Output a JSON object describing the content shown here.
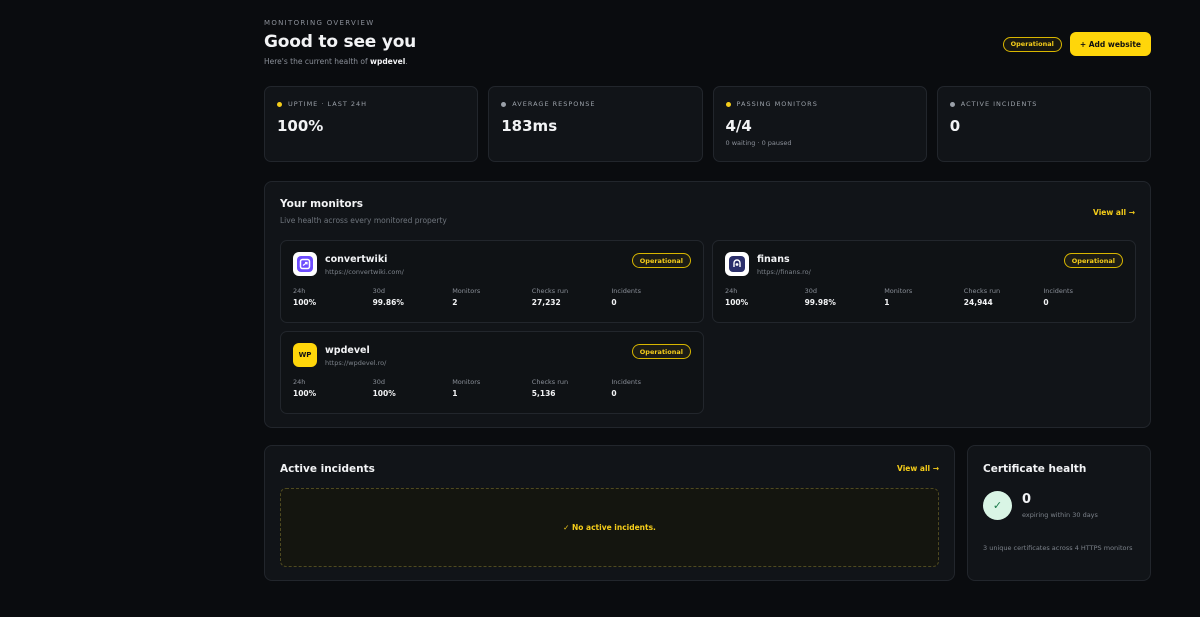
{
  "header": {
    "eyebrow": "MONITORING OVERVIEW",
    "title": "Good to see you",
    "subtitle_prefix": "Here's the current health of ",
    "subtitle_site": "wpdevel",
    "subtitle_suffix": ".",
    "status_pill": "Operational",
    "add_button": "+ Add website"
  },
  "stats": [
    {
      "label": "UPTIME · LAST 24H",
      "value": "100%",
      "sub": "",
      "dot": "yellow"
    },
    {
      "label": "AVERAGE RESPONSE",
      "value": "183ms",
      "sub": "",
      "dot": "gray"
    },
    {
      "label": "PASSING MONITORS",
      "value": "4/4",
      "sub": "0 waiting · 0 paused",
      "dot": "yellow"
    },
    {
      "label": "ACTIVE INCIDENTS",
      "value": "0",
      "sub": "",
      "dot": "gray"
    }
  ],
  "monitors": {
    "title": "Your monitors",
    "subtitle": "Live health across every monitored property",
    "view_all": "View all →",
    "columns": [
      "24h",
      "30d",
      "Monitors",
      "Checks run",
      "Incidents"
    ],
    "items": [
      {
        "name": "convertwiki",
        "url": "https://convertwiki.com/",
        "status": "Operational",
        "logo": "convertwiki-logo",
        "values": [
          "100%",
          "99.86%",
          "2",
          "27,232",
          "0"
        ]
      },
      {
        "name": "finans",
        "url": "https://finans.ro/",
        "status": "Operational",
        "logo": "finans-logo",
        "values": [
          "100%",
          "99.98%",
          "1",
          "24,944",
          "0"
        ]
      },
      {
        "name": "wpdevel",
        "url": "https://wpdevel.ro/",
        "status": "Operational",
        "logo": "wp-logo",
        "logo_text": "WP",
        "values": [
          "100%",
          "100%",
          "1",
          "5,136",
          "0"
        ]
      }
    ]
  },
  "incidents": {
    "title": "Active incidents",
    "view_all": "View all →",
    "empty_text": "✓  No active incidents."
  },
  "certificates": {
    "title": "Certificate health",
    "value": "0",
    "label": "expiring within 30 days",
    "note": "3 unique certificates across 4 HTTPS monitors"
  },
  "colors": {
    "accent": "#ffd60a",
    "background": "#0a0c0f",
    "card": "#111418",
    "success": "#d9f5e5"
  }
}
